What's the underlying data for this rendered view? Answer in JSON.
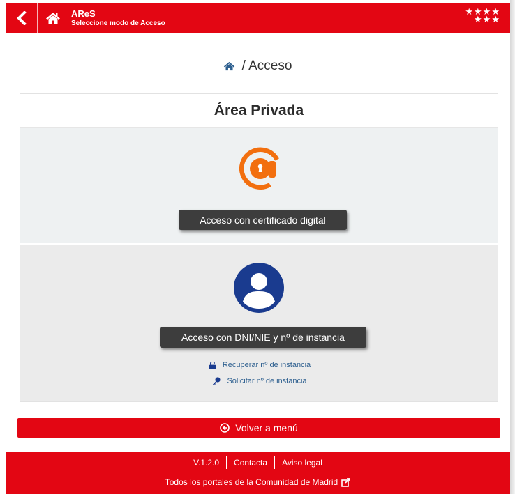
{
  "header": {
    "app_name": "AReS",
    "subtitle": "Seleccione modo de Acceso",
    "stars_top": "★★★★",
    "stars_bottom": "★★★",
    "back_icon": "chevron-left-icon",
    "home_icon": "home-icon"
  },
  "breadcrumb": {
    "icon": "home-icon",
    "text": "/ Acceso"
  },
  "panel": {
    "title": "Área Privada",
    "cert": {
      "icon": "certificate-at-lock-icon",
      "button_label": "Acceso con certificado digital"
    },
    "dni": {
      "icon": "user-circle-icon",
      "button_label": "Acceso con DNI/NIE y nº de instancia",
      "links": [
        {
          "icon": "unlock-icon",
          "label": "Recuperar nº de instancia"
        },
        {
          "icon": "key-icon",
          "label": "Solicitar nº de instancia"
        }
      ]
    }
  },
  "back_menu": {
    "icon": "arrow-left-circle-icon",
    "label": "Volver a menú"
  },
  "footer": {
    "version": "V.1.2.0",
    "contact": "Contacta",
    "legal": "Aviso legal",
    "portals": "Todos los portales de la Comunidad de Madrid",
    "portals_icon": "external-link-icon"
  },
  "colors": {
    "brand_red": "#e30613",
    "accent_orange": "#f26f0f",
    "user_blue": "#1a3b8f",
    "link_blue": "#2d5f8f",
    "button_dark": "#3d3d3d"
  }
}
